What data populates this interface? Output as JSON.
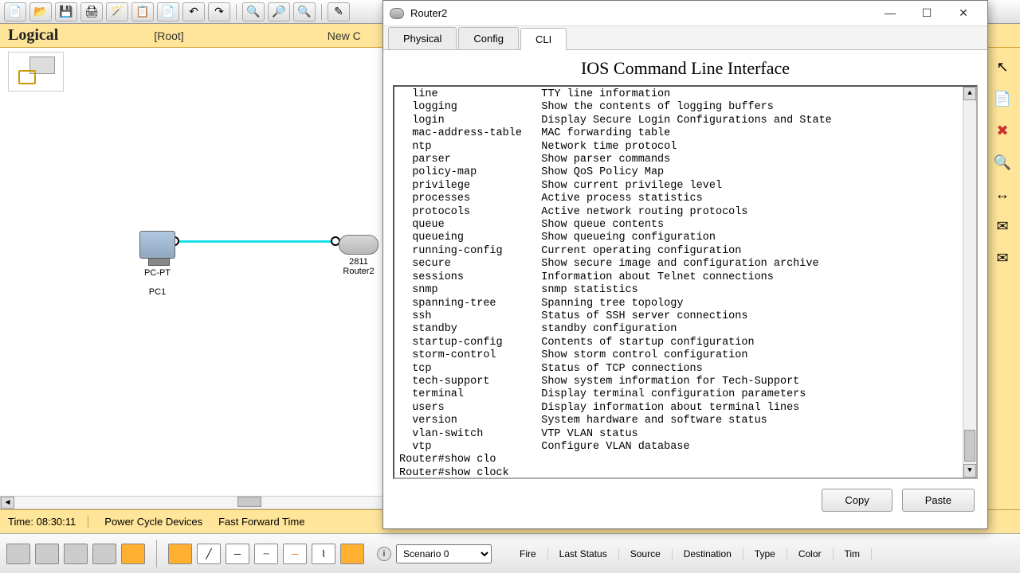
{
  "toolbar": {
    "icons": [
      "new",
      "open",
      "save",
      "print",
      "wizard",
      "copy",
      "paste",
      "undo",
      "redo",
      "",
      "zoomin",
      "zoomreset",
      "zoomout",
      "",
      "draw"
    ]
  },
  "secondary": {
    "logical": "Logical",
    "root": "[Root]",
    "newc": "New C"
  },
  "devices": {
    "pc_name": "PC-PT",
    "pc_label": "PC1",
    "router_model": "2811",
    "router_name": "Router2"
  },
  "status": {
    "time": "Time: 08:30:11",
    "power": "Power Cycle Devices",
    "ff": "Fast Forward Time"
  },
  "palette": {
    "scenario": "Scenario 0",
    "cols": [
      "Fire",
      "Last Status",
      "Source",
      "Destination",
      "Type",
      "Color",
      "Tim"
    ]
  },
  "window": {
    "title": "Router2",
    "tabs": [
      "Physical",
      "Config",
      "CLI"
    ],
    "active_tab": 2,
    "cli_title": "IOS Command Line Interface",
    "copy": "Copy",
    "paste": "Paste"
  },
  "cli_help": [
    {
      "cmd": "line",
      "desc": "TTY line information"
    },
    {
      "cmd": "logging",
      "desc": "Show the contents of logging buffers"
    },
    {
      "cmd": "login",
      "desc": "Display Secure Login Configurations and State"
    },
    {
      "cmd": "mac-address-table",
      "desc": "MAC forwarding table"
    },
    {
      "cmd": "ntp",
      "desc": "Network time protocol"
    },
    {
      "cmd": "parser",
      "desc": "Show parser commands"
    },
    {
      "cmd": "policy-map",
      "desc": "Show QoS Policy Map"
    },
    {
      "cmd": "privilege",
      "desc": "Show current privilege level"
    },
    {
      "cmd": "processes",
      "desc": "Active process statistics"
    },
    {
      "cmd": "protocols",
      "desc": "Active network routing protocols"
    },
    {
      "cmd": "queue",
      "desc": "Show queue contents"
    },
    {
      "cmd": "queueing",
      "desc": "Show queueing configuration"
    },
    {
      "cmd": "running-config",
      "desc": "Current operating configuration"
    },
    {
      "cmd": "secure",
      "desc": "Show secure image and configuration archive"
    },
    {
      "cmd": "sessions",
      "desc": "Information about Telnet connections"
    },
    {
      "cmd": "snmp",
      "desc": "snmp statistics"
    },
    {
      "cmd": "spanning-tree",
      "desc": "Spanning tree topology"
    },
    {
      "cmd": "ssh",
      "desc": "Status of SSH server connections"
    },
    {
      "cmd": "standby",
      "desc": "standby configuration"
    },
    {
      "cmd": "startup-config",
      "desc": "Contents of startup configuration"
    },
    {
      "cmd": "storm-control",
      "desc": "Show storm control configuration"
    },
    {
      "cmd": "tcp",
      "desc": "Status of TCP connections"
    },
    {
      "cmd": "tech-support",
      "desc": "Show system information for Tech-Support"
    },
    {
      "cmd": "terminal",
      "desc": "Display terminal configuration parameters"
    },
    {
      "cmd": "users",
      "desc": "Display information about terminal lines"
    },
    {
      "cmd": "version",
      "desc": "System hardware and software status"
    },
    {
      "cmd": "vlan-switch",
      "desc": "VTP VLAN status"
    },
    {
      "cmd": "vtp",
      "desc": "Configure VLAN database"
    }
  ],
  "cli_prompt_lines": [
    "Router#show clo",
    "Router#show clock"
  ]
}
